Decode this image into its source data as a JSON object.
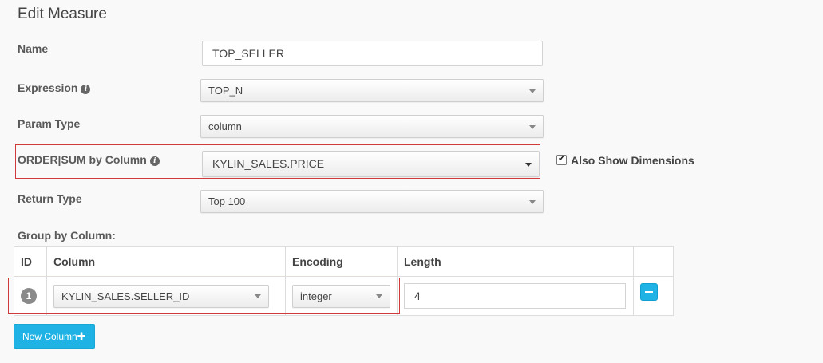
{
  "header": {
    "title": "Edit Measure"
  },
  "form": {
    "name_label": "Name",
    "name_value": "TOP_SELLER",
    "expression_label": "Expression",
    "expression_value": "TOP_N",
    "param_type_label": "Param Type",
    "param_type_value": "column",
    "order_label": "ORDER|SUM by Column",
    "order_value": "KYLIN_SALES.PRICE",
    "also_show_dimensions": "Also Show Dimensions",
    "return_type_label": "Return Type",
    "return_type_value": "Top 100",
    "group_by_label": "Group by Column:"
  },
  "table": {
    "headers": [
      "ID",
      "Column",
      "Encoding",
      "Length"
    ],
    "rows": [
      {
        "id": "1",
        "column": "KYLIN_SALES.SELLER_ID",
        "encoding": "integer",
        "length": "4"
      }
    ]
  },
  "actions": {
    "new_column": "New Column"
  },
  "icons": {
    "info": "info-icon",
    "plus": "plus-icon",
    "minus": "minus-icon",
    "check": "checkbox-checked-icon"
  },
  "colors": {
    "accent": "#1fb2e4",
    "highlight": "#d03a3a"
  }
}
